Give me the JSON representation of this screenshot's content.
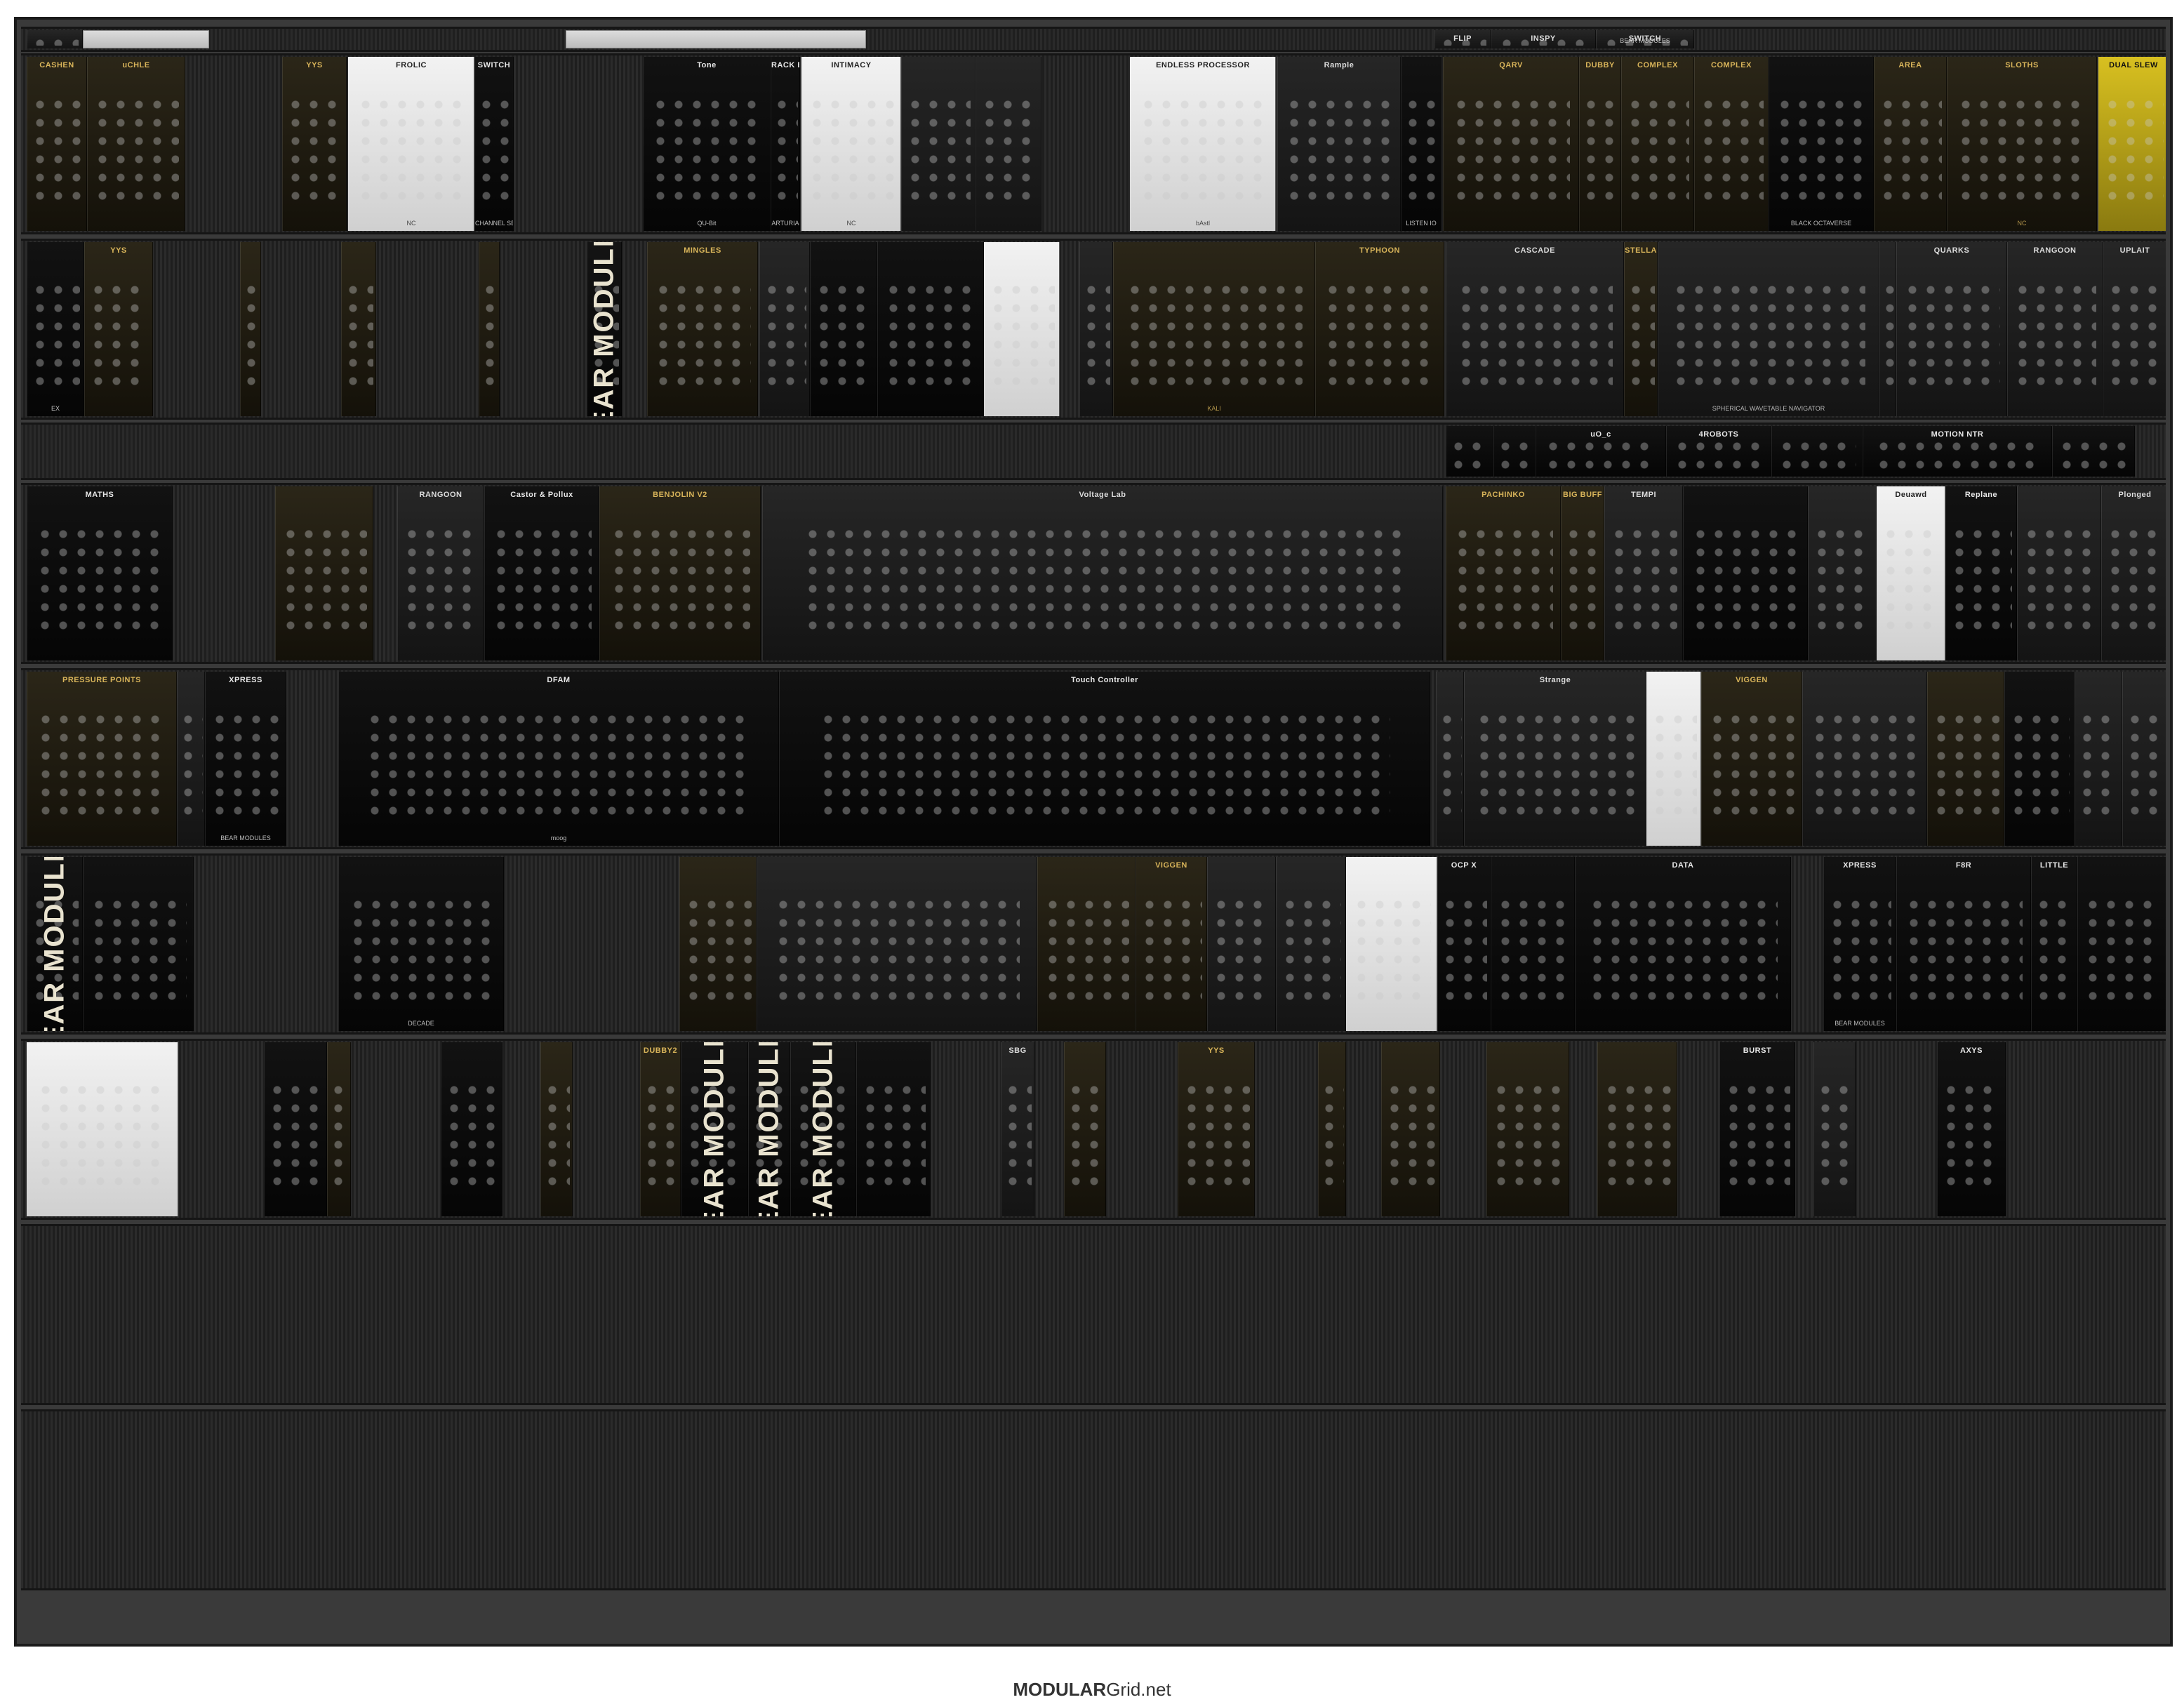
{
  "footer": {
    "brand_bold": "MODULAR",
    "brand_rest": "Grid.net"
  },
  "theme": {
    "case_color": "#3a3a3a",
    "rail_color": "#242424",
    "panel_dark": "#1a1a1a",
    "panel_black": "#0e0e0e",
    "panel_silver": "#d6d6d6",
    "panel_white": "#ececec",
    "panel_gold": "#2a2416",
    "panel_yellow": "#c9a500"
  },
  "rows": [
    {
      "id": "row-1",
      "modules": [
        {
          "label": "",
          "style": "dark"
        },
        {
          "label": "",
          "style": "blank"
        },
        {
          "label": "",
          "style": "blank"
        },
        {
          "label": "FLIP",
          "style": "dark"
        },
        {
          "label": "INSPY",
          "style": "dark"
        },
        {
          "label": "SWITCH",
          "style": "dark",
          "brand": "BEAR MODULES"
        }
      ]
    },
    {
      "id": "row-2",
      "modules": [
        {
          "label": "CASHEN",
          "style": "gold"
        },
        {
          "label": "uCHLE",
          "style": "gold"
        },
        {
          "label": "YYS",
          "style": "gold"
        },
        {
          "label": "FROLIC",
          "style": "white",
          "brand": "NC"
        },
        {
          "label": "SWITCH",
          "style": "black",
          "brand": "CHANNEL SELECT"
        },
        {
          "label": "Tone",
          "style": "black",
          "brand": "QU-Bit"
        },
        {
          "label": "RACK BRUTE",
          "style": "black",
          "brand": "ARTURIA"
        },
        {
          "label": "INTIMACY",
          "style": "white",
          "brand": "NC"
        },
        {
          "label": "",
          "style": "dark"
        },
        {
          "label": "",
          "style": "dark"
        },
        {
          "label": "ENDLESS PROCESSOR",
          "style": "white",
          "brand": "bAstl"
        },
        {
          "label": "Rample",
          "style": "dark"
        },
        {
          "label": "",
          "style": "black",
          "brand": "LISTEN IO"
        },
        {
          "label": "QARV",
          "style": "gold"
        },
        {
          "label": "DUBBY",
          "style": "gold"
        },
        {
          "label": "COMPLEX",
          "style": "gold"
        },
        {
          "label": "COMPLEX",
          "style": "gold"
        },
        {
          "label": "",
          "style": "black",
          "brand": "BLACK OCTAVERSE"
        },
        {
          "label": "AREA",
          "style": "gold"
        },
        {
          "label": "SLOTHS",
          "style": "gold",
          "brand": "NC"
        },
        {
          "label": "DUAL SLEW",
          "style": "yellow"
        }
      ]
    },
    {
      "id": "row-3",
      "modules": [
        {
          "label": "",
          "style": "black",
          "brand": "EX"
        },
        {
          "label": "YYS",
          "style": "gold"
        },
        {
          "label": "",
          "style": "gold"
        },
        {
          "label": "",
          "style": "gold"
        },
        {
          "label": "",
          "style": "gold"
        },
        {
          "label": "BEAR MODULES",
          "style": "bear"
        },
        {
          "label": "MINGLES",
          "style": "gold"
        },
        {
          "label": "",
          "style": "dark"
        },
        {
          "label": "",
          "style": "black"
        },
        {
          "label": "",
          "style": "black"
        },
        {
          "label": "",
          "style": "white"
        },
        {
          "label": "",
          "style": "dark"
        },
        {
          "label": "",
          "style": "gold",
          "brand": "KALI"
        },
        {
          "label": "TYPHOON",
          "style": "gold"
        },
        {
          "label": "CASCADE",
          "style": "dark"
        },
        {
          "label": "STELLA",
          "style": "gold"
        },
        {
          "label": "",
          "style": "dark",
          "brand": "SPHERICAL WAVETABLE NAVIGATOR"
        },
        {
          "label": "",
          "style": "dark"
        },
        {
          "label": "QUARKS",
          "style": "dark"
        },
        {
          "label": "RANGOON",
          "style": "dark"
        },
        {
          "label": "UPLAIT",
          "style": "dark"
        }
      ]
    },
    {
      "id": "row-4",
      "modules": [
        {
          "label": "",
          "style": "black"
        },
        {
          "label": "",
          "style": "black"
        },
        {
          "label": "uO_c",
          "style": "black"
        },
        {
          "label": "4ROBOTS",
          "style": "black"
        },
        {
          "label": "",
          "style": "black"
        },
        {
          "label": "MOTION NTR",
          "style": "black"
        },
        {
          "label": "",
          "style": "black"
        }
      ]
    },
    {
      "id": "row-5",
      "modules": [
        {
          "label": "MATHS",
          "style": "black"
        },
        {
          "label": "",
          "style": "gold"
        },
        {
          "label": "RANGOON",
          "style": "dark"
        },
        {
          "label": "Castor & Pollux",
          "style": "black"
        },
        {
          "label": "BENJOLIN V2",
          "style": "gold"
        },
        {
          "label": "Voltage Lab",
          "style": "dark"
        },
        {
          "label": "PACHINKO",
          "style": "gold"
        },
        {
          "label": "BIG BUFF",
          "style": "gold"
        },
        {
          "label": "TEMPI",
          "style": "dark"
        },
        {
          "label": "",
          "style": "black"
        },
        {
          "label": "",
          "style": "dark"
        },
        {
          "label": "Deuawd",
          "style": "white"
        },
        {
          "label": "Replane",
          "style": "black"
        },
        {
          "label": "",
          "style": "dark"
        },
        {
          "label": "Plonged",
          "style": "dark"
        }
      ]
    },
    {
      "id": "row-6",
      "modules": [
        {
          "label": "PRESSURE POINTS",
          "style": "gold"
        },
        {
          "label": "",
          "style": "dark"
        },
        {
          "label": "XPRESS",
          "style": "black",
          "brand": "BEAR MODULES"
        },
        {
          "label": "DFAM",
          "style": "black",
          "brand": "moog"
        },
        {
          "label": "Touch Controller",
          "style": "black"
        },
        {
          "label": "",
          "style": "dark"
        },
        {
          "label": "Strange",
          "style": "dark"
        },
        {
          "label": "",
          "style": "white"
        },
        {
          "label": "VIGGEN",
          "style": "gold"
        },
        {
          "label": "",
          "style": "dark"
        },
        {
          "label": "",
          "style": "gold"
        },
        {
          "label": "",
          "style": "black"
        },
        {
          "label": "",
          "style": "dark"
        },
        {
          "label": "",
          "style": "dark"
        }
      ]
    },
    {
      "id": "row-7",
      "modules": [
        {
          "label": "BEAR MODULES",
          "style": "bear"
        },
        {
          "label": "",
          "style": "black"
        },
        {
          "label": "",
          "style": "black",
          "brand": "DECADE"
        },
        {
          "label": "",
          "style": "gold"
        },
        {
          "label": "",
          "style": "dark"
        },
        {
          "label": "",
          "style": "gold"
        },
        {
          "label": "VIGGEN",
          "style": "gold"
        },
        {
          "label": "",
          "style": "dark"
        },
        {
          "label": "",
          "style": "dark"
        },
        {
          "label": "",
          "style": "white"
        },
        {
          "label": "OCP X",
          "style": "black"
        },
        {
          "label": "",
          "style": "black"
        },
        {
          "label": "DATA",
          "style": "black"
        },
        {
          "label": "XPRESS",
          "style": "black",
          "brand": "BEAR MODULES"
        },
        {
          "label": "F8R",
          "style": "black"
        },
        {
          "label": "LITTLE",
          "style": "black"
        },
        {
          "label": "",
          "style": "black"
        }
      ]
    },
    {
      "id": "row-8",
      "modules": [
        {
          "label": "",
          "style": "white"
        },
        {
          "label": "",
          "style": "black"
        },
        {
          "label": "",
          "style": "gold"
        },
        {
          "label": "",
          "style": "black"
        },
        {
          "label": "",
          "style": "gold"
        },
        {
          "label": "DUBBY2",
          "style": "gold"
        },
        {
          "label": "BEAR MODULES",
          "style": "bear"
        },
        {
          "label": "BEAR MODULES",
          "style": "bear"
        },
        {
          "label": "BEAR MODULES",
          "style": "bear"
        },
        {
          "label": "",
          "style": "black"
        },
        {
          "label": "SBG",
          "style": "dark"
        },
        {
          "label": "",
          "style": "gold"
        },
        {
          "label": "YYS",
          "style": "gold"
        },
        {
          "label": "",
          "style": "gold"
        },
        {
          "label": "",
          "style": "gold"
        },
        {
          "label": "",
          "style": "gold"
        },
        {
          "label": "",
          "style": "gold"
        },
        {
          "label": "BURST",
          "style": "black"
        },
        {
          "label": "",
          "style": "dark"
        },
        {
          "label": "AXYS",
          "style": "black"
        }
      ]
    },
    {
      "id": "row-9",
      "modules": []
    },
    {
      "id": "row-10",
      "modules": []
    }
  ]
}
